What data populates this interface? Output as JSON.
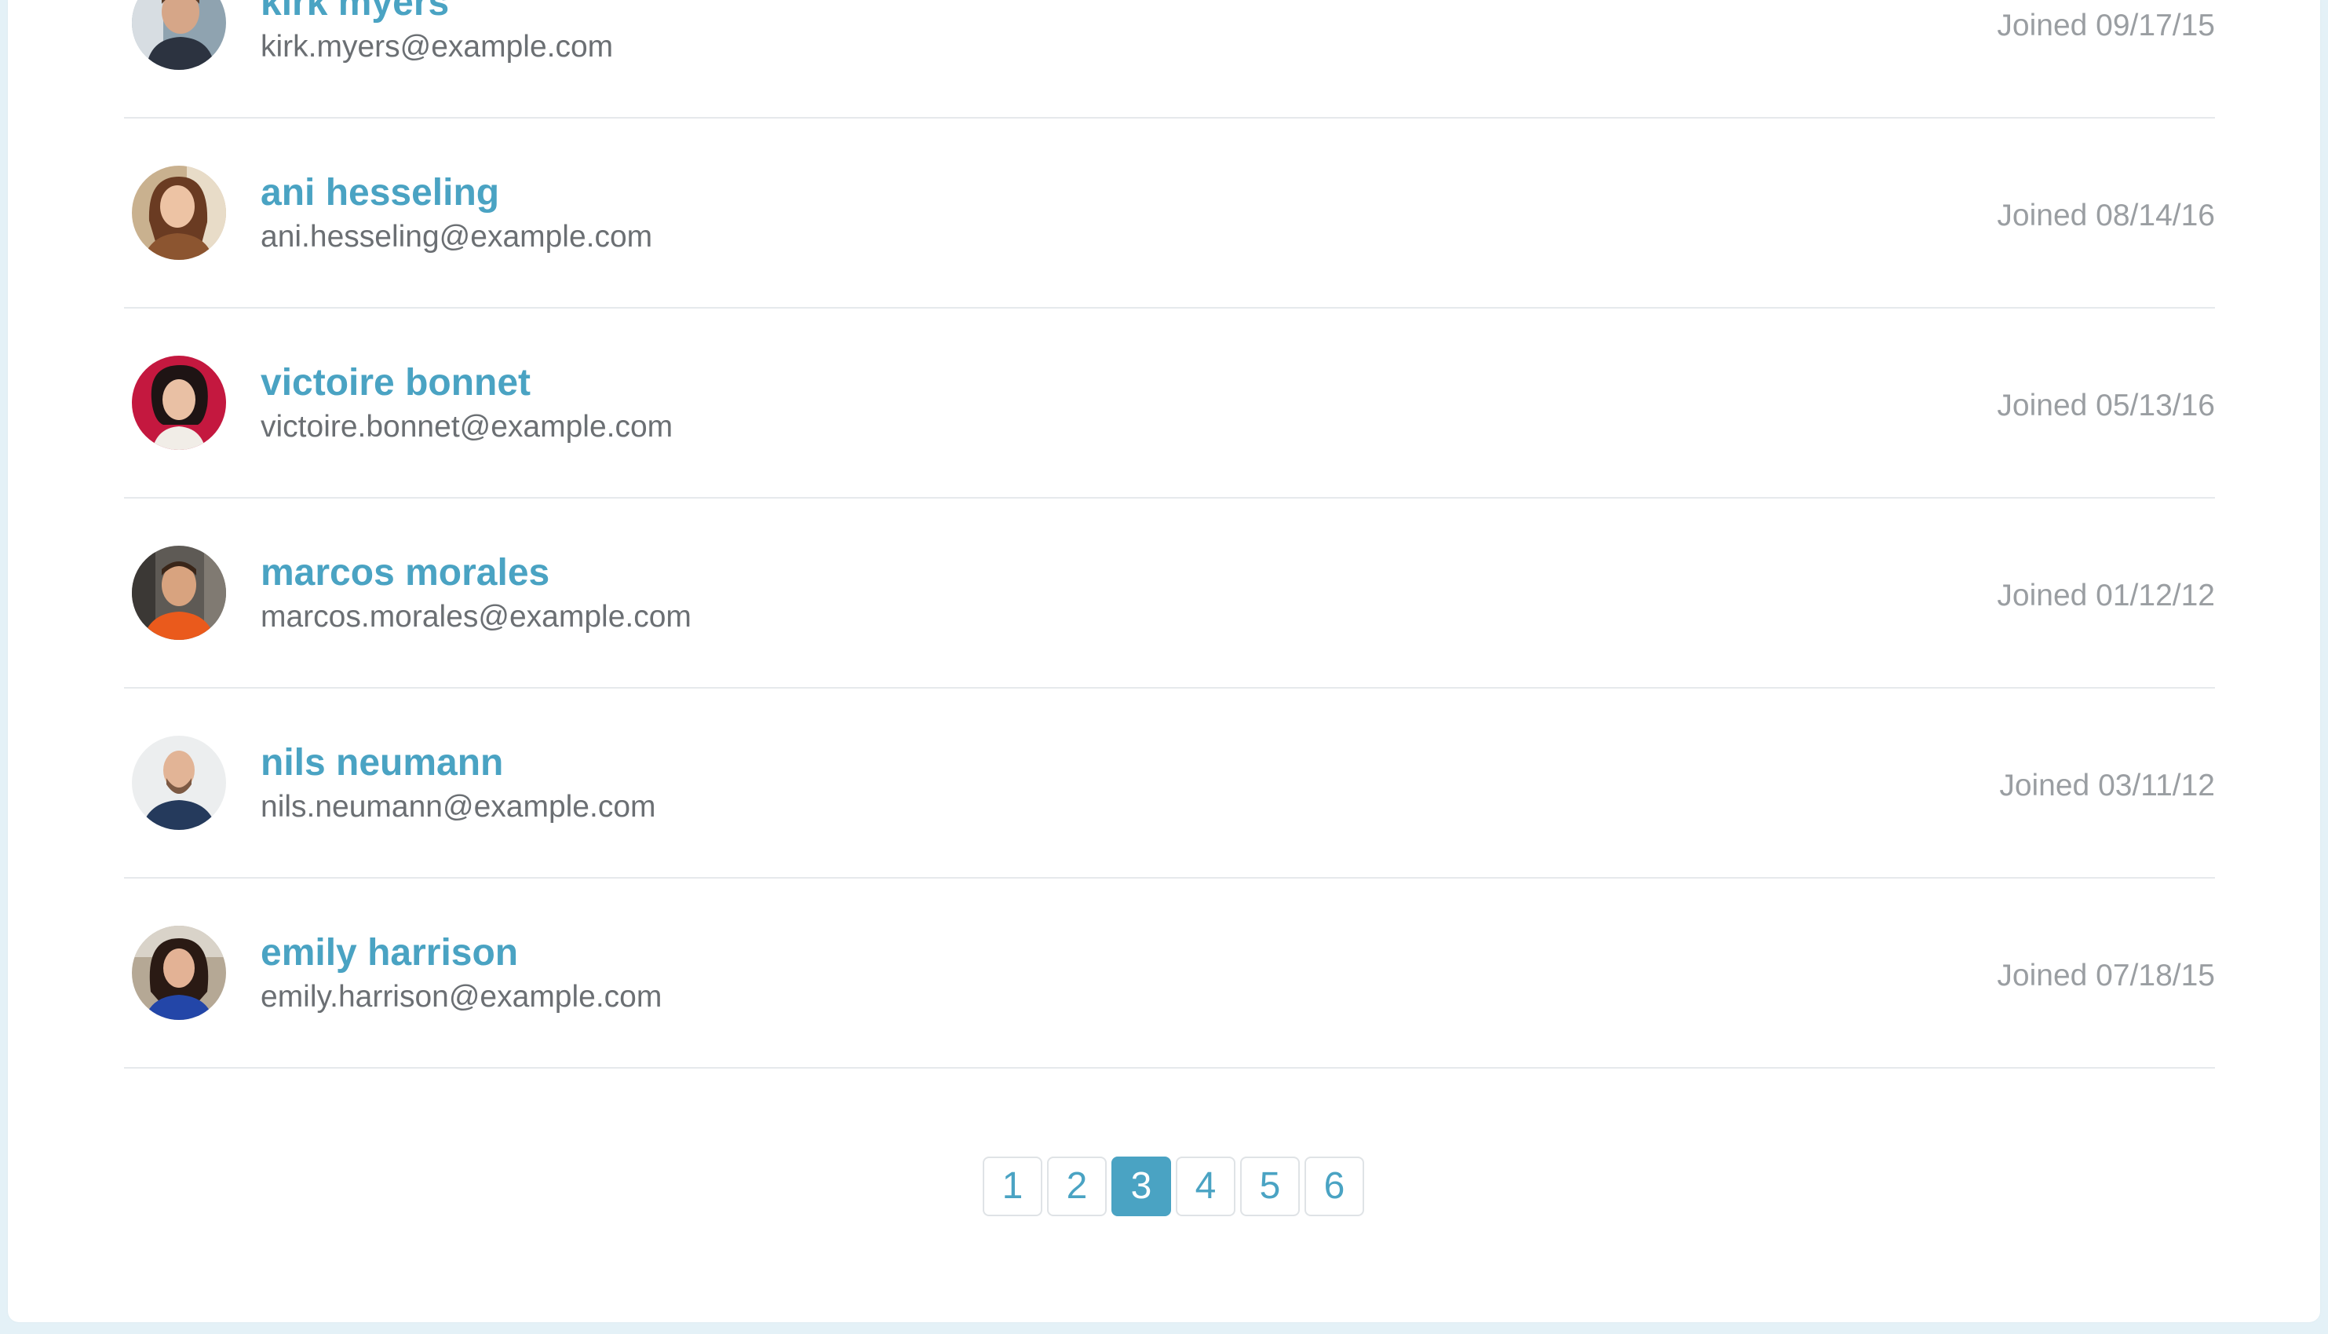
{
  "users": [
    {
      "name": "kirk myers",
      "email": "kirk.myers@example.com",
      "joined": "Joined 09/17/15"
    },
    {
      "name": "ani hesseling",
      "email": "ani.hesseling@example.com",
      "joined": "Joined 08/14/16"
    },
    {
      "name": "victoire bonnet",
      "email": "victoire.bonnet@example.com",
      "joined": "Joined 05/13/16"
    },
    {
      "name": "marcos morales",
      "email": "marcos.morales@example.com",
      "joined": "Joined 01/12/12"
    },
    {
      "name": "nils neumann",
      "email": "nils.neumann@example.com",
      "joined": "Joined 03/11/12"
    },
    {
      "name": "emily harrison",
      "email": "emily.harrison@example.com",
      "joined": "Joined 07/18/15"
    }
  ],
  "pagination": {
    "pages": [
      "1",
      "2",
      "3",
      "4",
      "5",
      "6"
    ],
    "current": "3"
  },
  "colors": {
    "accent": "#4aa3c3",
    "page_background": "#e4f1f7",
    "email_text": "#6b6f73",
    "joined_text": "#9a9ea2",
    "divider": "#e6e9ec"
  }
}
